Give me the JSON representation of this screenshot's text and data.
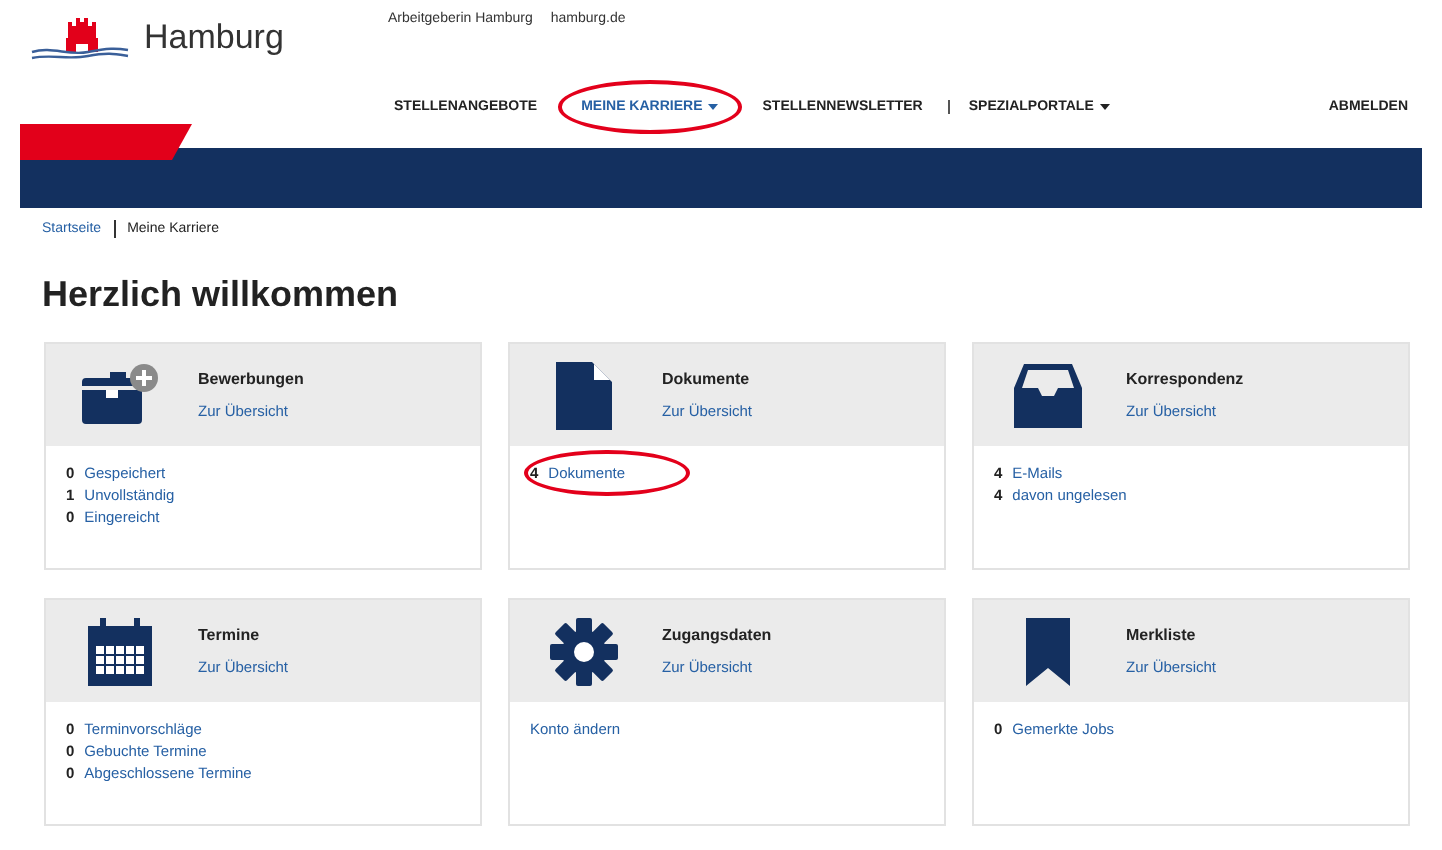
{
  "logo": {
    "text": "Hamburg"
  },
  "top_links": [
    "Arbeitgeberin Hamburg",
    "hamburg.de"
  ],
  "nav": [
    {
      "label": "STELLENANGEBOTE",
      "selected": false,
      "dropdown": false,
      "divider_before": false,
      "circled": false
    },
    {
      "label": "MEINE KARRIERE",
      "selected": true,
      "dropdown": true,
      "divider_before": false,
      "circled": true
    },
    {
      "label": "STELLENNEWSLETTER",
      "selected": false,
      "dropdown": false,
      "divider_before": false,
      "circled": false
    },
    {
      "label": "SPEZIALPORTALE",
      "selected": false,
      "dropdown": true,
      "divider_before": true,
      "circled": false
    }
  ],
  "logout": "ABMELDEN",
  "breadcrumb": [
    {
      "label": "Startseite",
      "link": true
    },
    {
      "label": "Meine Karriere",
      "link": false
    }
  ],
  "heading": "Herzlich willkommen",
  "cards": [
    {
      "kind": "briefcase",
      "title": "Bewerbungen",
      "overview": "Zur Übersicht",
      "items": [
        {
          "count": "0",
          "label": "Gespeichert",
          "circled": false
        },
        {
          "count": "1",
          "label": "Unvollständig",
          "circled": false
        },
        {
          "count": "0",
          "label": "Eingereicht",
          "circled": false
        }
      ]
    },
    {
      "kind": "document",
      "title": "Dokumente",
      "overview": "Zur Übersicht",
      "items": [
        {
          "count": "4",
          "label": "Dokumente",
          "circled": true
        }
      ]
    },
    {
      "kind": "inbox",
      "title": "Korrespondenz",
      "overview": "Zur Übersicht",
      "items": [
        {
          "count": "4",
          "label": "E-Mails",
          "circled": false
        },
        {
          "count": "4",
          "label": "davon ungelesen",
          "circled": false
        }
      ]
    },
    {
      "kind": "calendar",
      "title": "Termine",
      "overview": "Zur Übersicht",
      "items": [
        {
          "count": "0",
          "label": "Terminvorschläge",
          "circled": false
        },
        {
          "count": "0",
          "label": "Gebuchte Termine",
          "circled": false
        },
        {
          "count": "0",
          "label": "Abgeschlossene Termine",
          "circled": false
        }
      ]
    },
    {
      "kind": "gear",
      "title": "Zugangsdaten",
      "overview": "Zur Übersicht",
      "items": [
        {
          "label": "Konto ändern",
          "circled": false
        }
      ]
    },
    {
      "kind": "bookmark",
      "title": "Merkliste",
      "overview": "Zur Übersicht",
      "items": [
        {
          "count": "0",
          "label": "Gemerkte Jobs",
          "circled": false
        }
      ]
    }
  ]
}
